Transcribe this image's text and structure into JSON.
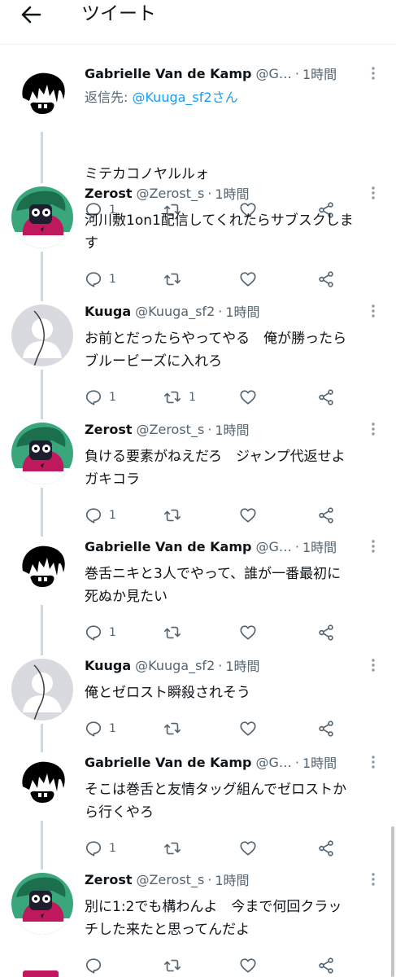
{
  "header": {
    "title": "ツイート",
    "back_icon": "arrow-left-icon"
  },
  "reply_prefix": "返信先: ",
  "tweets": [
    {
      "avatar": "gabrielle",
      "name": "Gabrielle Van de Kamp",
      "handle": "@G…",
      "sep": "·",
      "time": "1時間",
      "reply_to": "@Kuuga_sf2さん",
      "text": "ミテカコノヤルルォ",
      "replies": "1",
      "retweets": "",
      "likes": ""
    },
    {
      "avatar": "zerost",
      "name": "Zerost",
      "handle": "@Zerost_s",
      "sep": "·",
      "time": "1時間",
      "text": "河川敷1on1配信してくれたらサブスクしま\nす",
      "replies": "1",
      "retweets": "",
      "likes": ""
    },
    {
      "avatar": "kuuga",
      "name": "Kuuga",
      "handle": "@Kuuga_sf2",
      "sep": "·",
      "time": "1時間",
      "text": "お前とだったらやってやる　俺が勝ったら\nブルービーズに入れろ",
      "replies": "1",
      "retweets": "1",
      "likes": ""
    },
    {
      "avatar": "zerost",
      "name": "Zerost",
      "handle": "@Zerost_s",
      "sep": "·",
      "time": "1時間",
      "text": "負ける要素がねえだろ　ジャンプ代返せよ\nガキコラ",
      "replies": "1",
      "retweets": "",
      "likes": ""
    },
    {
      "avatar": "gabrielle",
      "name": "Gabrielle Van de Kamp",
      "handle": "@G…",
      "sep": "·",
      "time": "1時間",
      "text": "巻舌ニキと3人でやって、誰が一番最初に\n死ぬか見たい",
      "replies": "1",
      "retweets": "",
      "likes": ""
    },
    {
      "avatar": "kuuga",
      "name": "Kuuga",
      "handle": "@Kuuga_sf2",
      "sep": "·",
      "time": "1時間",
      "text": "俺とゼロスト瞬殺されそう",
      "replies": "1",
      "retweets": "",
      "likes": ""
    },
    {
      "avatar": "gabrielle",
      "name": "Gabrielle Van de Kamp",
      "handle": "@G…",
      "sep": "·",
      "time": "1時間",
      "text": "そこは巻舌と友情タッグ組んでゼロストか\nら行くやろ",
      "replies": "1",
      "retweets": "",
      "likes": ""
    },
    {
      "avatar": "zerost",
      "name": "Zerost",
      "handle": "@Zerost_s",
      "sep": "·",
      "time": "1時間",
      "text": "別に1:2でも構わんよ　今まで何回クラッ\nチした来たと思ってんだよ",
      "replies": "",
      "retweets": "",
      "likes": ""
    }
  ],
  "colors": {
    "text": "#0f1419",
    "secondary": "#536471",
    "link": "#1d9bf0",
    "thread_line": "#cfd9de"
  }
}
